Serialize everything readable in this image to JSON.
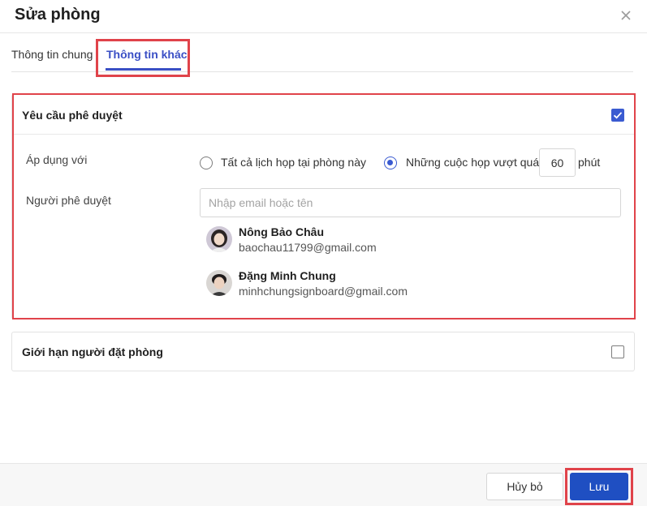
{
  "dialog": {
    "title": "Sửa phòng"
  },
  "tabs": [
    {
      "label": "Thông tin chung",
      "active": false
    },
    {
      "label": "Thông tin khác",
      "active": true
    }
  ],
  "approval": {
    "title": "Yêu cầu phê duyệt",
    "enabled": true,
    "apply_label": "Áp dụng với",
    "option_all": "Tất cả lịch họp tại phòng này",
    "option_exceed": "Những cuộc họp vượt quá",
    "minutes_value": "60",
    "minutes_unit": "phút",
    "approver_label": "Người phê duyệt",
    "approver_placeholder": "Nhập email hoặc tên",
    "approvers": [
      {
        "name": "Nông Bảo Châu",
        "email": "baochau11799@gmail.com"
      },
      {
        "name": "Đặng Minh Chung",
        "email": "minhchungsignboard@gmail.com"
      }
    ]
  },
  "limit": {
    "title": "Giới hạn người đặt phòng",
    "enabled": false
  },
  "footer": {
    "cancel_label": "Hủy bỏ",
    "save_label": "Lưu"
  },
  "colors": {
    "accent": "#3a4fc5",
    "primary_button": "#1f4fc2",
    "highlight": "#e0434a"
  }
}
